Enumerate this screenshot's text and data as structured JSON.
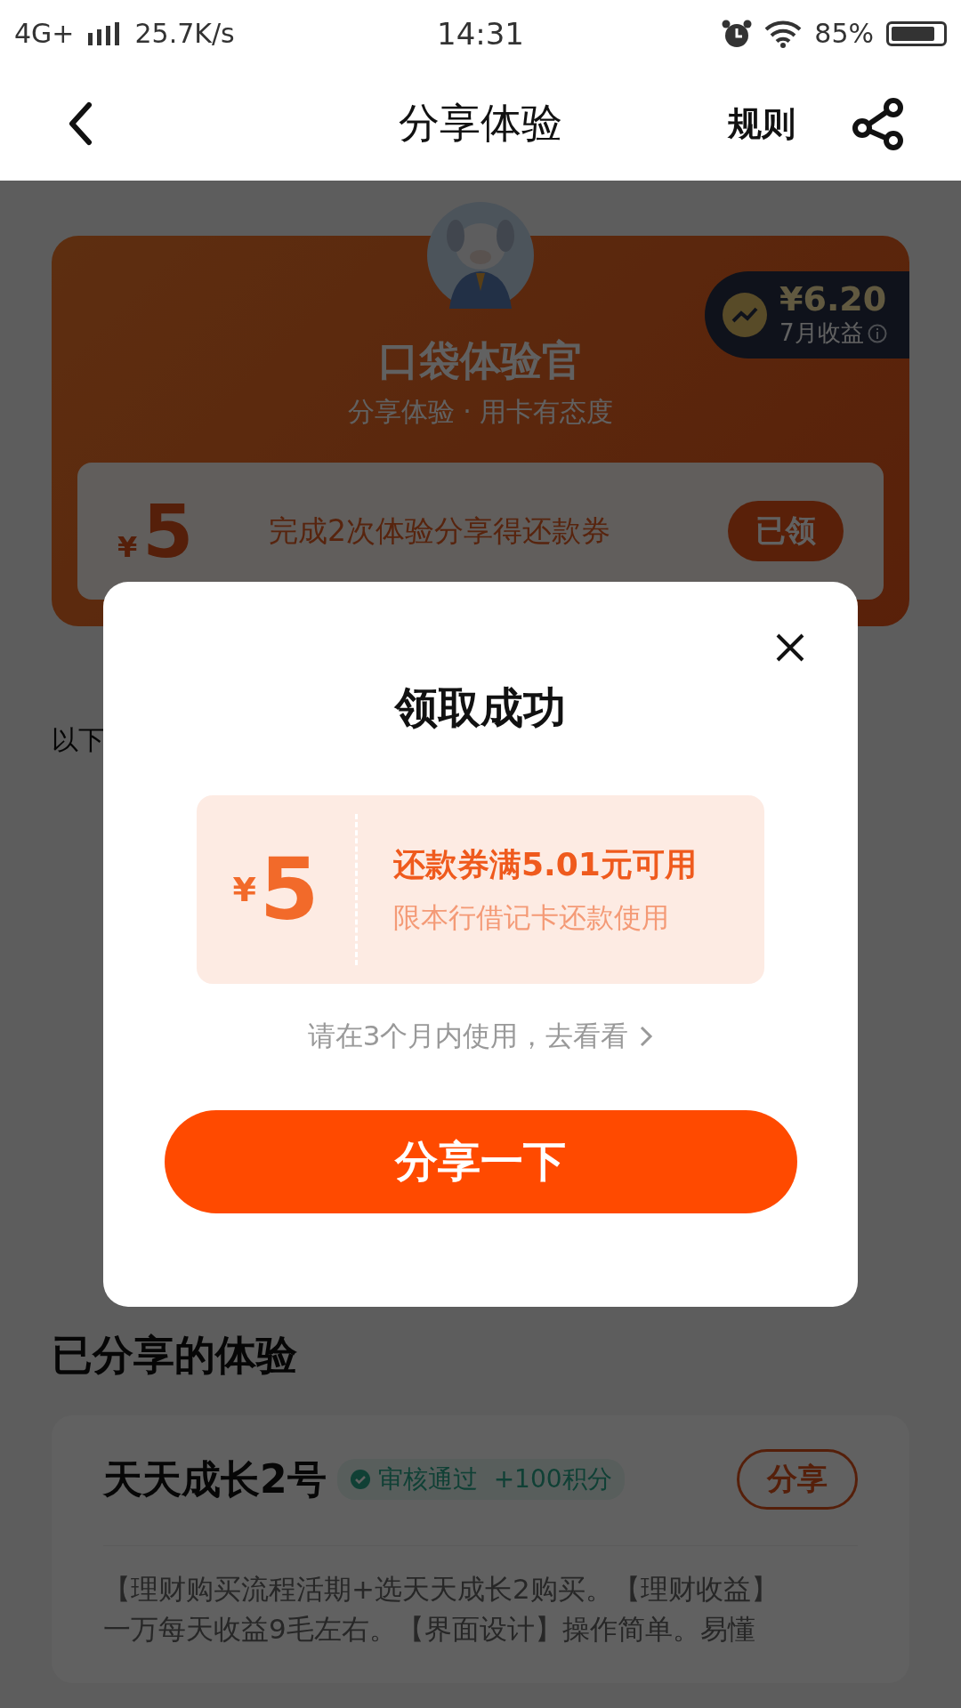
{
  "status_bar": {
    "network": "4G+",
    "speed": "25.7K/s",
    "time": "14:31",
    "battery": "85%"
  },
  "nav": {
    "title": "分享体验",
    "rules": "规则"
  },
  "hero": {
    "title": "口袋体验官",
    "subtitle": "分享体验 · 用卡有态度",
    "earnings": {
      "amount": "¥6.20",
      "label": "7月收益"
    },
    "task": {
      "currency": "¥",
      "amount": "5",
      "text": "完成2次体验分享得还款券",
      "button": "已领"
    }
  },
  "hint": "以下",
  "section_title": "已分享的体验",
  "experiences": [
    {
      "title": "天天成长2号",
      "status": "审核通过",
      "points": "+100积分",
      "button": "分享",
      "description_lines": [
        "【理财购买流程活期+选天天成长2购买。【理财收益】",
        "一万每天收益9毛左右。【界面设计】操作简单。易懂"
      ]
    }
  ],
  "dialog": {
    "title": "领取成功",
    "coupon": {
      "currency": "¥",
      "amount": "5",
      "title": "还款券满5.01元可用",
      "note": "限本行借记卡还款使用"
    },
    "hint": "请在3个月内使用，去看看",
    "button": "分享一下"
  }
}
